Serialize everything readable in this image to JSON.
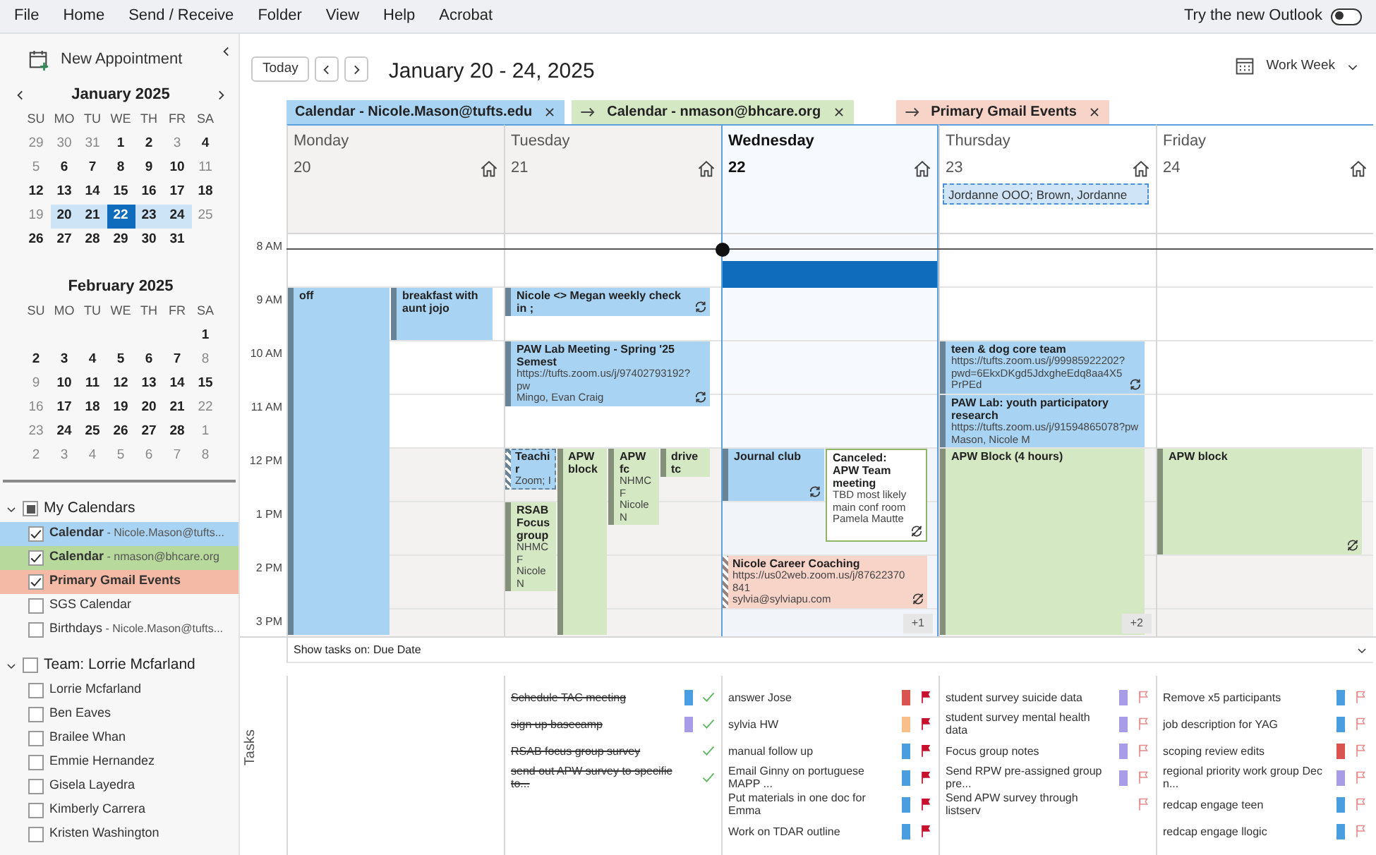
{
  "menu": [
    "File",
    "Home",
    "Send / Receive",
    "Folder",
    "View",
    "Help",
    "Acrobat"
  ],
  "try_new": {
    "label": "Try the new Outlook",
    "on": false
  },
  "sidebar": {
    "new_button": "New Appointment",
    "months": [
      {
        "title": "January 2025",
        "weekdays": [
          "SU",
          "MO",
          "TU",
          "WE",
          "TH",
          "FR",
          "SA"
        ],
        "weeks": [
          [
            {
              "t": "29",
              "busy": false,
              "in_view": false,
              "selected": false
            },
            {
              "t": "30",
              "busy": false,
              "in_view": false,
              "selected": false
            },
            {
              "t": "31",
              "busy": false,
              "in_view": false,
              "selected": false
            },
            {
              "t": "1",
              "busy": true,
              "in_view": false,
              "selected": false
            },
            {
              "t": "2",
              "busy": true,
              "in_view": false,
              "selected": false
            },
            {
              "t": "3",
              "busy": false,
              "in_view": false,
              "selected": false
            },
            {
              "t": "4",
              "busy": true,
              "in_view": false,
              "selected": false
            }
          ],
          [
            {
              "t": "5",
              "busy": false,
              "in_view": false,
              "selected": false
            },
            {
              "t": "6",
              "busy": true,
              "in_view": false,
              "selected": false
            },
            {
              "t": "7",
              "busy": true,
              "in_view": false,
              "selected": false
            },
            {
              "t": "8",
              "busy": true,
              "in_view": false,
              "selected": false
            },
            {
              "t": "9",
              "busy": true,
              "in_view": false,
              "selected": false
            },
            {
              "t": "10",
              "busy": true,
              "in_view": false,
              "selected": false
            },
            {
              "t": "11",
              "busy": false,
              "in_view": false,
              "selected": false
            }
          ],
          [
            {
              "t": "12",
              "busy": true,
              "in_view": false,
              "selected": false
            },
            {
              "t": "13",
              "busy": true,
              "in_view": false,
              "selected": false
            },
            {
              "t": "14",
              "busy": true,
              "in_view": false,
              "selected": false
            },
            {
              "t": "15",
              "busy": true,
              "in_view": false,
              "selected": false
            },
            {
              "t": "16",
              "busy": true,
              "in_view": false,
              "selected": false
            },
            {
              "t": "17",
              "busy": true,
              "in_view": false,
              "selected": false
            },
            {
              "t": "18",
              "busy": true,
              "in_view": false,
              "selected": false
            }
          ],
          [
            {
              "t": "19",
              "busy": false,
              "in_view": false,
              "selected": false
            },
            {
              "t": "20",
              "busy": true,
              "in_view": true,
              "selected": false
            },
            {
              "t": "21",
              "busy": true,
              "in_view": true,
              "selected": false
            },
            {
              "t": "22",
              "busy": true,
              "in_view": true,
              "selected": true
            },
            {
              "t": "23",
              "busy": true,
              "in_view": true,
              "selected": false
            },
            {
              "t": "24",
              "busy": true,
              "in_view": true,
              "selected": false
            },
            {
              "t": "25",
              "busy": false,
              "in_view": false,
              "selected": false
            }
          ],
          [
            {
              "t": "26",
              "busy": true,
              "in_view": false,
              "selected": false
            },
            {
              "t": "27",
              "busy": true,
              "in_view": false,
              "selected": false
            },
            {
              "t": "28",
              "busy": true,
              "in_view": false,
              "selected": false
            },
            {
              "t": "29",
              "busy": true,
              "in_view": false,
              "selected": false
            },
            {
              "t": "30",
              "busy": true,
              "in_view": false,
              "selected": false
            },
            {
              "t": "31",
              "busy": true,
              "in_view": false,
              "selected": false
            }
          ]
        ]
      },
      {
        "title": "February 2025",
        "weekdays": [
          "SU",
          "MO",
          "TU",
          "WE",
          "TH",
          "FR",
          "SA"
        ],
        "weeks": [
          [
            {
              "t": "1",
              "busy": true,
              "in_view": false,
              "selected": false
            }
          ],
          [
            {
              "t": "2",
              "busy": true,
              "in_view": false,
              "selected": false
            },
            {
              "t": "3",
              "busy": true,
              "in_view": false,
              "selected": false
            },
            {
              "t": "4",
              "busy": true,
              "in_view": false,
              "selected": false
            },
            {
              "t": "5",
              "busy": true,
              "in_view": false,
              "selected": false
            },
            {
              "t": "6",
              "busy": true,
              "in_view": false,
              "selected": false
            },
            {
              "t": "7",
              "busy": true,
              "in_view": false,
              "selected": false
            },
            {
              "t": "8",
              "busy": false,
              "in_view": false,
              "selected": false
            }
          ],
          [
            {
              "t": "9",
              "busy": false,
              "in_view": false,
              "selected": false
            },
            {
              "t": "10",
              "busy": true,
              "in_view": false,
              "selected": false
            },
            {
              "t": "11",
              "busy": true,
              "in_view": false,
              "selected": false
            },
            {
              "t": "12",
              "busy": true,
              "in_view": false,
              "selected": false
            },
            {
              "t": "13",
              "busy": true,
              "in_view": false,
              "selected": false
            },
            {
              "t": "14",
              "busy": true,
              "in_view": false,
              "selected": false
            },
            {
              "t": "15",
              "busy": true,
              "in_view": false,
              "selected": false
            }
          ],
          [
            {
              "t": "16",
              "busy": false,
              "in_view": false,
              "selected": false
            },
            {
              "t": "17",
              "busy": true,
              "in_view": false,
              "selected": false
            },
            {
              "t": "18",
              "busy": true,
              "in_view": false,
              "selected": false
            },
            {
              "t": "19",
              "busy": true,
              "in_view": false,
              "selected": false
            },
            {
              "t": "20",
              "busy": true,
              "in_view": false,
              "selected": false
            },
            {
              "t": "21",
              "busy": true,
              "in_view": false,
              "selected": false
            },
            {
              "t": "22",
              "busy": false,
              "in_view": false,
              "selected": false
            }
          ],
          [
            {
              "t": "23",
              "busy": false,
              "in_view": false,
              "selected": false
            },
            {
              "t": "24",
              "busy": true,
              "in_view": false,
              "selected": false
            },
            {
              "t": "25",
              "busy": true,
              "in_view": false,
              "selected": false
            },
            {
              "t": "26",
              "busy": true,
              "in_view": false,
              "selected": false
            },
            {
              "t": "27",
              "busy": true,
              "in_view": false,
              "selected": false
            },
            {
              "t": "28",
              "busy": true,
              "in_view": false,
              "selected": false
            },
            {
              "t": "1",
              "busy": false,
              "in_view": false,
              "selected": false
            }
          ],
          [
            {
              "t": "2",
              "busy": false,
              "in_view": false,
              "selected": false
            },
            {
              "t": "3",
              "busy": false,
              "in_view": false,
              "selected": false
            },
            {
              "t": "4",
              "busy": false,
              "in_view": false,
              "selected": false
            },
            {
              "t": "5",
              "busy": false,
              "in_view": false,
              "selected": false
            },
            {
              "t": "6",
              "busy": false,
              "in_view": false,
              "selected": false
            },
            {
              "t": "7",
              "busy": false,
              "in_view": false,
              "selected": false
            },
            {
              "t": "8",
              "busy": false,
              "in_view": false,
              "selected": false
            }
          ]
        ]
      }
    ],
    "groups": [
      {
        "label": "My Calendars",
        "expanded": true,
        "partial": true,
        "items": [
          {
            "name": "Calendar",
            "account": "- Nicole.Mason@tufts...",
            "checked": true,
            "color": "#a9d3f2"
          },
          {
            "name": "Calendar",
            "account": "- nmason@bhcare.org",
            "checked": true,
            "color": "#b8d99c"
          },
          {
            "name": "Primary Gmail Events",
            "checked": true,
            "color": "#f5baa6"
          },
          {
            "name": "SGS Calendar",
            "checked": false
          },
          {
            "name": "Birthdays",
            "account": "- Nicole.Mason@tufts...",
            "checked": false
          }
        ]
      },
      {
        "label": "Team: Lorrie Mcfarland",
        "expanded": true,
        "partial": false,
        "items": [
          {
            "name": "Lorrie Mcfarland",
            "checked": false
          },
          {
            "name": "Ben Eaves",
            "checked": false
          },
          {
            "name": "Brailee Whan",
            "checked": false
          },
          {
            "name": "Emmie Hernandez",
            "checked": false
          },
          {
            "name": "Gisela Layedra",
            "checked": false
          },
          {
            "name": "Kimberly Carrera",
            "checked": false
          },
          {
            "name": "Kristen Washington",
            "checked": false
          }
        ]
      }
    ]
  },
  "toolbar": {
    "today": "Today",
    "title": "January 20 - 24, 2025",
    "view": "Work Week"
  },
  "tabs": [
    {
      "label": "Calendar - Nicole.Mason@tufts.edu",
      "overlay": false,
      "color": "#a9d3f2"
    },
    {
      "label": "Calendar - nmason@bhcare.org",
      "overlay": true,
      "color": "#d5e8c4"
    },
    {
      "label": "Primary Gmail Events",
      "overlay": true,
      "color": "#f8d3c8"
    }
  ],
  "time_labels": [
    "8 AM",
    "9 AM",
    "10 AM",
    "11 AM",
    "12 PM",
    "1 PM",
    "2 PM",
    "3 PM"
  ],
  "tasks_bar": "Show tasks on: Due Date",
  "tasks_label": "Tasks",
  "days": [
    {
      "name": "Monday",
      "date": "20",
      "past": true,
      "today": false,
      "events": [
        {
          "title": "off",
          "color": "#a9d3f2"
        },
        {
          "title": "breakfast with aunt jojo",
          "color": "#a9d3f2"
        }
      ]
    },
    {
      "name": "Tuesday",
      "date": "21",
      "past": true,
      "today": false,
      "events": [
        {
          "title": "Nicole <> Megan weekly check in ;",
          "color": "#a9d3f2",
          "recurring": true
        },
        {
          "title": "PAW Lab Meeting - Spring '25 Semest",
          "lines": [
            "https://tufts.zoom.us/j/97402793192?pw",
            "Mingo, Evan Craig"
          ],
          "color": "#a9d3f2",
          "recurring": true
        },
        {
          "title": "Teachir",
          "lines": [
            "Zoom; I"
          ],
          "color": "#a9d3f2",
          "tentative": true
        },
        {
          "title": "APW block",
          "color": "#d5e8c4"
        },
        {
          "title": "APW fc",
          "lines": [
            "NHMCF",
            "Nicole N"
          ],
          "color": "#d5e8c4"
        },
        {
          "title": "drive tc",
          "color": "#d5e8c4"
        },
        {
          "title": "RSAB Focus group",
          "lines": [
            "NHMCF",
            "Nicole N"
          ],
          "color": "#d5e8c4"
        }
      ],
      "tasks": [
        {
          "text": "Schedule TAC meeting",
          "done": true,
          "color": "#4a9ee0"
        },
        {
          "text": "sign up basecamp",
          "done": true,
          "color": "#a99ce6"
        },
        {
          "text": "RSAB focus group survey",
          "done": true
        },
        {
          "text": "send out APW survey to specific to...",
          "done": true
        }
      ]
    },
    {
      "name": "Wednesday",
      "date": "22",
      "past": false,
      "today": true,
      "events": [
        {
          "title": "Journal club",
          "color": "#a9d3f2",
          "recurring": true
        },
        {
          "title": "Canceled: APW Team meeting",
          "lines": [
            "TBD most likely main conf room",
            "Pamela Mautte"
          ],
          "color": "#8db665",
          "canceled": true,
          "exception": true
        },
        {
          "title": "Nicole Career Coaching",
          "lines": [
            "https://us02web.zoom.us/j/87622370841",
            "sylvia@sylviapu.com"
          ],
          "color": "#f8d3c8",
          "tentative": true,
          "exception": true
        }
      ],
      "more": "+1",
      "tasks": [
        {
          "text": "answer Jose",
          "done": false,
          "color": "#d9534f",
          "due_today": true
        },
        {
          "text": "sylvia HW",
          "done": false,
          "color": "#f7c08a",
          "due_today": true
        },
        {
          "text": "manual follow up",
          "done": false,
          "color": "#4a9ee0",
          "due_today": true
        },
        {
          "text": "Email Ginny on portuguese MAPP ...",
          "done": false,
          "color": "#4a9ee0",
          "due_today": true
        },
        {
          "text": "Put materials in one doc for Emma",
          "done": false,
          "color": "#4a9ee0",
          "due_today": true
        },
        {
          "text": "Work on TDAR outline",
          "done": false,
          "color": "#4a9ee0",
          "due_today": true
        }
      ]
    },
    {
      "name": "Thursday",
      "date": "23",
      "past": false,
      "today": false,
      "all_day": [
        {
          "title": "Jordanne OOO; Brown, Jordanne",
          "color": "#cfe5f7",
          "free": true
        }
      ],
      "events": [
        {
          "title": "teen & dog core team",
          "lines": [
            "https://tufts.zoom.us/j/99985922202?pwd=6EkxDKgd5JdxgheEdq8aa4X5PrPEd"
          ],
          "color": "#a9d3f2",
          "recurring": true
        },
        {
          "title": "PAW Lab: youth participatory research",
          "lines": [
            "https://tufts.zoom.us/j/91594865078?pw",
            "Mason, Nicole M"
          ],
          "color": "#a9d3f2"
        },
        {
          "title": "APW Block (4 hours)",
          "color": "#d5e8c4"
        }
      ],
      "more": "+2",
      "tasks": [
        {
          "text": "student survey suicide data",
          "done": false,
          "color": "#a99ce6",
          "due_today": false
        },
        {
          "text": "student survey mental health data",
          "done": false,
          "color": "#a99ce6",
          "due_today": false
        },
        {
          "text": "Focus group notes",
          "done": false,
          "color": "#a99ce6",
          "due_today": false
        },
        {
          "text": "Send RPW pre-assigned group pre...",
          "done": false,
          "color": "#a99ce6",
          "due_today": false
        },
        {
          "text": "Send APW survey through listserv",
          "done": false,
          "due_today": false
        }
      ]
    },
    {
      "name": "Friday",
      "date": "24",
      "past": false,
      "today": false,
      "events": [
        {
          "title": "APW block",
          "color": "#d5e8c4",
          "exception": true
        }
      ],
      "tasks": [
        {
          "text": "Remove x5 participants",
          "done": false,
          "color": "#4a9ee0",
          "due_today": false
        },
        {
          "text": "job description for YAG",
          "done": false,
          "color": "#4a9ee0",
          "due_today": false
        },
        {
          "text": "scoping review edits",
          "done": false,
          "color": "#d9534f",
          "due_today": false
        },
        {
          "text": "regional priority work group Dec n...",
          "done": false,
          "color": "#a99ce6",
          "due_today": false
        },
        {
          "text": "redcap engage teen",
          "done": false,
          "color": "#4a9ee0",
          "due_today": false
        },
        {
          "text": "redcap engage llogic",
          "done": false,
          "color": "#4a9ee0",
          "due_today": false
        }
      ]
    }
  ]
}
